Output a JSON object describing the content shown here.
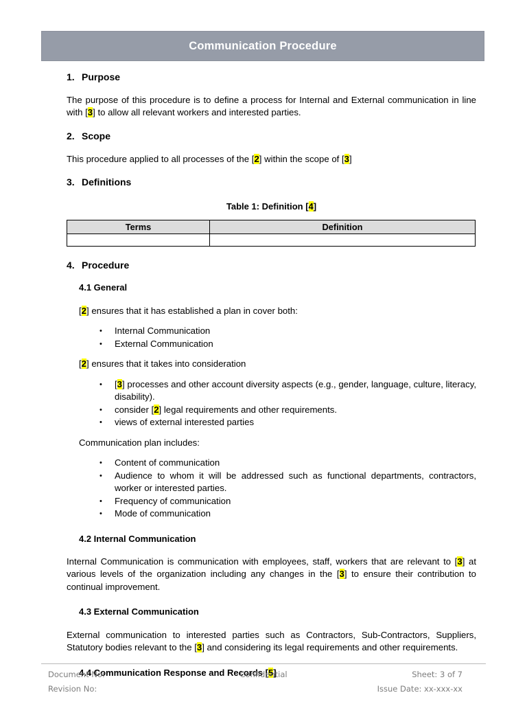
{
  "document": {
    "banner_title": "Communication Procedure",
    "banner_color": "#969CA8",
    "highlight_color": "#FFFF00"
  },
  "sections": {
    "purpose": {
      "number": "1.",
      "title": "Purpose",
      "para_a": "The purpose of this procedure is to define a process for Internal and External communication in line with [",
      "token_3": "3",
      "para_b": "] to allow all relevant workers and interested parties."
    },
    "scope": {
      "number": "2.",
      "title": "Scope",
      "para_a": "This procedure applied to all processes of the [",
      "token_2": "2",
      "para_b": "] within the scope of [",
      "token_3": "3",
      "para_c": "]"
    },
    "definitions": {
      "number": "3.",
      "title": "Definitions",
      "caption_a": "Table 1: Definition [",
      "caption_token": "4",
      "caption_b": "]",
      "table": {
        "headers": [
          "Terms",
          "Definition"
        ],
        "rows": [
          [
            "",
            ""
          ]
        ]
      }
    },
    "procedure": {
      "number": "4.",
      "title": "Procedure",
      "general": {
        "title": "4.1 General",
        "intro1_a": "[",
        "intro1_token": "2",
        "intro1_b": "] ensures that it has established a plan in cover both:",
        "bullets1": [
          "Internal Communication",
          "External Communication"
        ],
        "intro2_a": "[",
        "intro2_token": "2",
        "intro2_b": "] ensures that it takes into consideration",
        "bullet2a_a": "[",
        "bullet2a_token": "3",
        "bullet2a_b": "] processes and other account diversity aspects (e.g., gender, language, culture, literacy, disability).",
        "bullet2b_a": "consider [",
        "bullet2b_token": "2",
        "bullet2b_b": "] legal requirements and other requirements.",
        "bullet2c": "views of external interested parties",
        "intro3": "Communication plan includes:",
        "bullets3": [
          "Content of communication",
          "Audience to whom it will be addressed such as functional departments, contractors, worker or interested parties.",
          "Frequency of communication",
          "Mode of communication"
        ]
      },
      "internal": {
        "title": "4.2 Internal Communication",
        "para_a": "Internal Communication is communication with employees, staff, workers that are relevant to [",
        "token_1": "3",
        "para_b": "] at various levels of the organization including any changes in the [",
        "token_2": "3",
        "para_c": "] to ensure their contribution to continual improvement."
      },
      "external": {
        "title": "4.3 External Communication",
        "para_a": "External communication to interested parties such as Contractors, Sub-Contractors, Suppliers, Statutory bodies relevant to the [",
        "token_1": "3",
        "para_b": "] and considering its legal requirements and other requirements."
      },
      "response": {
        "title_a": "4.4 Communication Response and Records [",
        "title_token": "5",
        "title_b": "]"
      }
    }
  },
  "footer": {
    "document_no": "Document No:",
    "revision_no": "Revision No:",
    "confidential": "Confidential",
    "sheet": "Sheet: 3 of 7",
    "issue_date": "Issue Date: xx-xxx-xx"
  }
}
